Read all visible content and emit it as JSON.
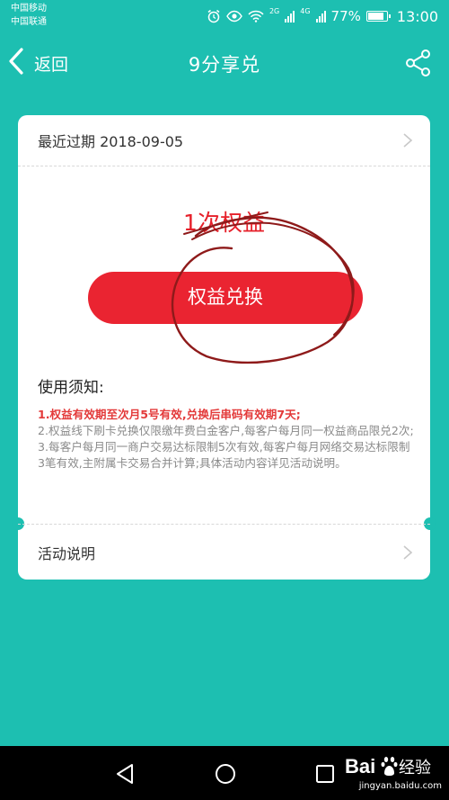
{
  "status_bar": {
    "carrier_1": "中国移动",
    "carrier_2": "中国联通",
    "net_2g": "2G",
    "net_4g": "4G",
    "battery": "77%",
    "time": "13:00"
  },
  "nav": {
    "back_label": "返回",
    "title": "9分享兑"
  },
  "card": {
    "expiry": "最近过期 2018-09-05",
    "benefit_count": "1次权益",
    "redeem_label": "权益兑换",
    "notice_title": "使用须知:",
    "notices": [
      "1.权益有效期至次月5号有效,兑换后串码有效期7天;",
      "2.权益线下刷卡兑换仅限缴年费白金客户,每客户每月同一权益商品限兑2次;",
      "3.每客户每月同一商户交易达标限制5次有效,每客户每月网络交易达标限制3笔有效,主附属卡交易合并计算;具体活动内容详见活动说明。"
    ],
    "activity_label": "活动说明"
  },
  "watermark": {
    "logo": "Baidu经验",
    "url": "jingyan.baidu.com"
  },
  "colors": {
    "background": "#1dbfb1",
    "accent_red": "#ea2431",
    "notice_red": "#e33a3a",
    "card": "#ffffff"
  }
}
